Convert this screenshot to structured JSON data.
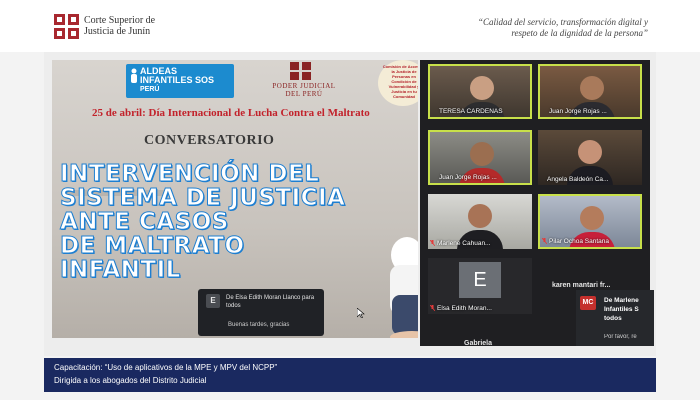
{
  "header": {
    "org_name_line1": "Corte Superior de",
    "org_name_line2": "Justicia de Junín",
    "motto_line1": "“Calidad del servicio, transformación digital y",
    "motto_line2": "respeto de la dignidad de la persona”"
  },
  "slide": {
    "sos_line1": "ALDEAS",
    "sos_line2": "INFANTILES SOS",
    "sos_line3": "PERÚ",
    "pj_line1": "PODER JUDICIAL",
    "pj_line2": "DEL PERÚ",
    "comision_text": "Comisión de Acceso a la Justicia de Personas en Condición de Vulnerabilidad y Justicia en tu Comunidad",
    "date_line": "25 de abril: Día Internacional de Lucha Contra el Maltrato",
    "subtitle": "CONVERSATORIO",
    "title_lines": [
      "INTERVENCIÓN DEL",
      "SISTEMA DE JUSTICIA",
      "ANTE CASOS",
      "DE MALTRATO",
      "INFANTIL"
    ]
  },
  "chat_popup": {
    "avatar_letter": "E",
    "from": "De Elsa Edith Moran Llanco para todos",
    "message": "Buenas tardes, gracias"
  },
  "participants": [
    {
      "name": "TERESA CARDENAS",
      "muted": false
    },
    {
      "name": "Juan Jorge Rojas ...",
      "muted": false
    },
    {
      "name": "Juan Jorge Rojas ...",
      "muted": false
    },
    {
      "name": "Angela Baldeón Ca...",
      "muted": false
    },
    {
      "name": "Marlene Cahuan...",
      "muted": true
    },
    {
      "name": "Pilar Ochoa Santana",
      "muted": true
    },
    {
      "name": "Elsa Edith Moran...",
      "muted": true,
      "avatar_letter": "E"
    }
  ],
  "karen_label": "karen mantari fr...",
  "gabriela_label": "Gabriela",
  "mc_chat": {
    "avatar_letter": "MC",
    "from": "De Marlene Infantiles S todos",
    "message": "Por favor, re"
  },
  "footer": {
    "line1": "Capacitación: “Uso de aplicativos  de la MPE y MPV del NCPP”",
    "line2": "Dirigida a los abogados del Distrito Judicial"
  },
  "colors": {
    "footer_bg": "#1a2960",
    "title_blue": "#1e7fd1",
    "date_red": "#c2222b",
    "active_speaker": "#c8e04a",
    "mc_red": "#c5302d"
  }
}
